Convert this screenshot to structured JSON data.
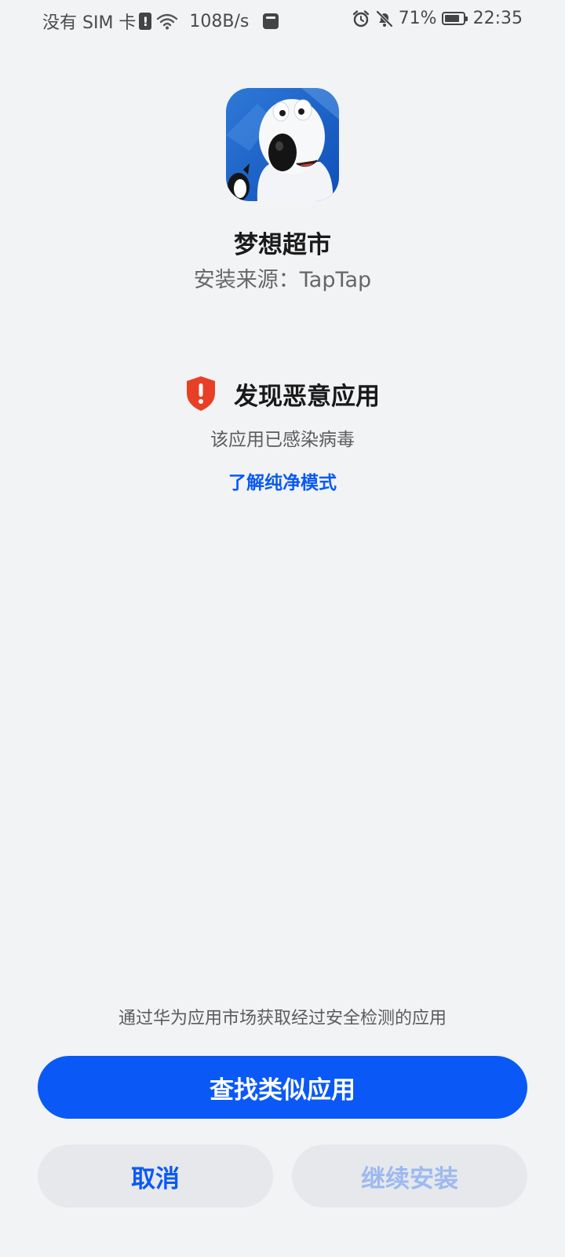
{
  "status_bar": {
    "sim": "没有 SIM 卡",
    "sim_alert": "!",
    "network_speed": "108B/s",
    "battery": "71%",
    "time": "22:35",
    "icons": [
      "sim-alert-icon",
      "wifi-icon",
      "huawei-icon",
      "alarm-icon",
      "bell-off-icon",
      "battery-icon"
    ]
  },
  "app": {
    "name": "梦想超市",
    "source": "安装来源：TapTap",
    "icon": "polar-bear-app-icon"
  },
  "warning": {
    "title": "发现恶意应用",
    "description": "该应用已感染病毒",
    "link": "了解纯净模式",
    "icon": "shield-alert-icon",
    "color": "#e84026"
  },
  "footer": {
    "hint": "通过华为应用市场获取经过安全检测的应用",
    "primary_button": "查找类似应用",
    "cancel_button": "取消",
    "continue_button": "继续安装"
  },
  "colors": {
    "accent": "#0a59f7",
    "background": "#f1f3f5",
    "disabled_text": "#9db9f0"
  }
}
